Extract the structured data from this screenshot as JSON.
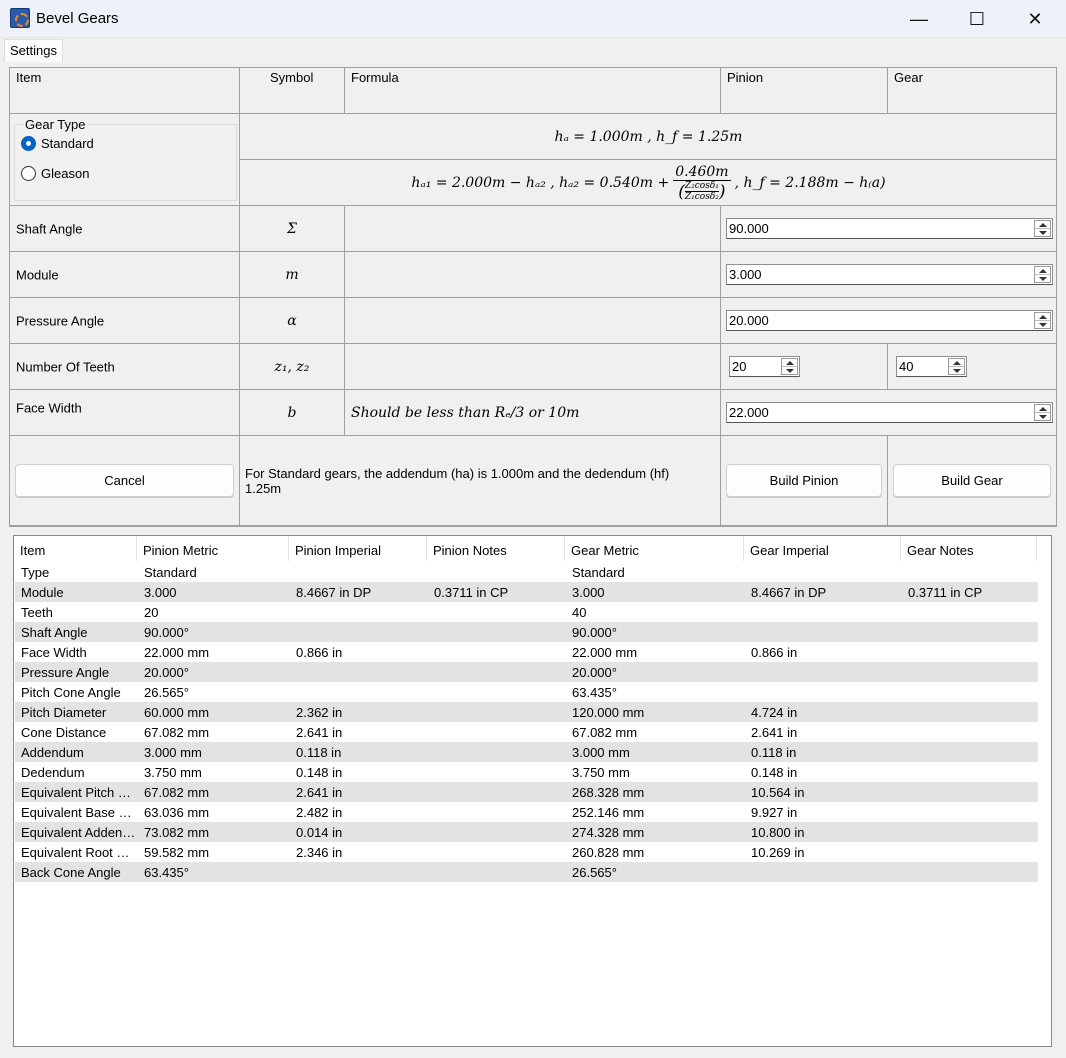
{
  "window": {
    "title": "Bevel Gears",
    "minimize": "—",
    "maximize": "☐",
    "close": "✕"
  },
  "menu": {
    "settings": "Settings"
  },
  "form": {
    "headers": {
      "item": "Item",
      "symbol": "Symbol",
      "formula": "Formula",
      "pinion": "Pinion",
      "gear": "Gear"
    },
    "gear_type": {
      "legend": "Gear Type",
      "standard": "Standard",
      "gleason": "Gleason",
      "selected": "Standard",
      "standard_formula": "hₐ = 1.000m , h_f = 1.25m",
      "gleason_formula_left": "hₐ₁ = 2.000m − hₐ₂ , hₐ₂ = 0.540m +",
      "gleason_formula_num": "0.460m",
      "gleason_formula_den_top": "Z₂cosδ₁",
      "gleason_formula_den_bot": "Z₁cosδ₂",
      "gleason_formula_right": ", h_f = 2.188m − h₍a)"
    },
    "rows": {
      "shaft_angle": {
        "label": "Shaft Angle",
        "symbol": "Σ",
        "value": "90.000"
      },
      "module": {
        "label": "Module",
        "symbol": "m",
        "value": "3.000"
      },
      "pressure_angle": {
        "label": "Pressure Angle",
        "symbol": "α",
        "value": "20.000"
      },
      "teeth": {
        "label": "Number Of Teeth",
        "symbol": "z₁, z₂",
        "pinion": "20",
        "gear": "40"
      },
      "face_width": {
        "label": "Face Width",
        "symbol": "b",
        "formula": "Should be less than Rₑ/3 or 10m",
        "value": "22.000"
      }
    },
    "buttons": {
      "cancel": "Cancel",
      "build_pinion": "Build Pinion",
      "build_gear": "Build Gear"
    },
    "note": "For Standard gears, the addendum (ha) is 1.000m and the dedendum (hf) 1.25m"
  },
  "results": {
    "headers": [
      "Item",
      "Pinion Metric",
      "Pinion Imperial",
      "Pinion Notes",
      "Gear Metric",
      "Gear Imperial",
      "Gear Notes"
    ],
    "rows": [
      [
        "Type",
        "Standard",
        "",
        "",
        "Standard",
        "",
        ""
      ],
      [
        "Module",
        "3.000",
        "8.4667 in DP",
        "0.3711 in CP",
        "3.000",
        "8.4667 in DP",
        "0.3711 in CP"
      ],
      [
        "Teeth",
        "20",
        "",
        "",
        "40",
        "",
        ""
      ],
      [
        "Shaft Angle",
        "90.000°",
        "",
        "",
        "90.000°",
        "",
        ""
      ],
      [
        "Face Width",
        "22.000 mm",
        "0.866 in",
        "",
        "22.000 mm",
        "0.866 in",
        ""
      ],
      [
        "Pressure Angle",
        "20.000°",
        "",
        "",
        "20.000°",
        "",
        ""
      ],
      [
        "Pitch Cone Angle",
        "26.565°",
        "",
        "",
        "63.435°",
        "",
        ""
      ],
      [
        "Pitch Diameter",
        "60.000 mm",
        "2.362 in",
        "",
        "120.000 mm",
        "4.724 in",
        ""
      ],
      [
        "Cone Distance",
        "67.082 mm",
        "2.641 in",
        "",
        "67.082 mm",
        "2.641 in",
        ""
      ],
      [
        "Addendum",
        "3.000 mm",
        "0.118 in",
        "",
        "3.000 mm",
        "0.118 in",
        ""
      ],
      [
        "Dedendum",
        "3.750 mm",
        "0.148 in",
        "",
        "3.750 mm",
        "0.148 in",
        ""
      ],
      [
        "Equivalent Pitch Diameter",
        "67.082 mm",
        "2.641 in",
        "",
        "268.328 mm",
        "10.564 in",
        ""
      ],
      [
        "Equivalent Base Diameter",
        "63.036 mm",
        "2.482 in",
        "",
        "252.146 mm",
        "9.927 in",
        ""
      ],
      [
        "Equivalent Addendum Diameter",
        "73.082 mm",
        "0.014 in",
        "",
        "274.328 mm",
        "10.800 in",
        ""
      ],
      [
        "Equivalent Root Diameter",
        "59.582 mm",
        "2.346 in",
        "",
        "260.828 mm",
        "10.269 in",
        ""
      ],
      [
        "Back Cone Angle",
        "63.435°",
        "",
        "",
        "26.565°",
        "",
        ""
      ]
    ]
  }
}
